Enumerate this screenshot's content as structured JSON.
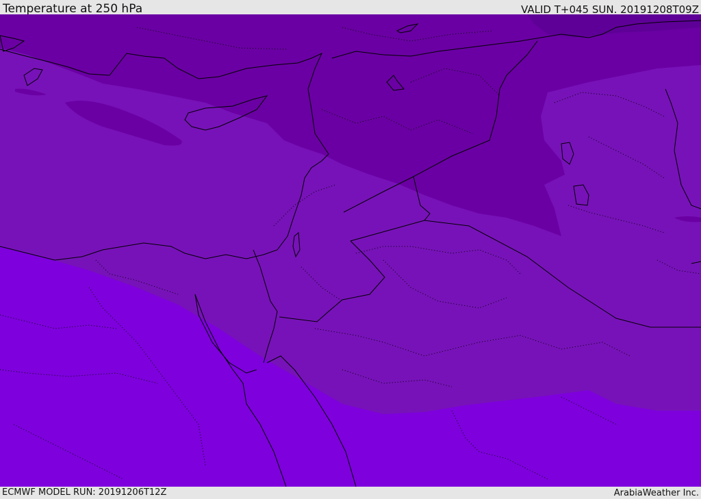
{
  "header": {
    "title": "Temperature at 250 hPa",
    "valid_time": "VALID T+045 SUN. 20191208T09Z"
  },
  "footer": {
    "model_run": "ECMWF MODEL RUN: 20191206T12Z",
    "credit": "ArabiaWeather Inc."
  },
  "colors": {
    "band_coldest": "#5e0097",
    "band_cold": "#6a00a3",
    "band_mid": "#7712b8",
    "band_warm": "#7e00dd",
    "coastline": "#000000",
    "border": "#000000"
  }
}
